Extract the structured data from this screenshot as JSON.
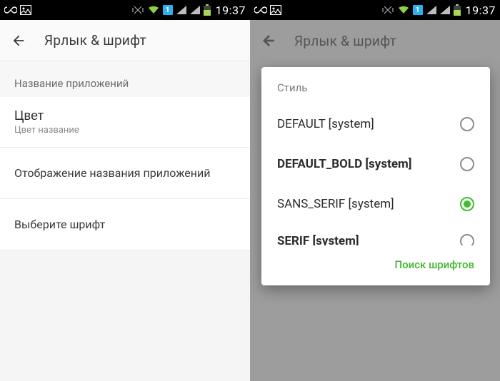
{
  "status": {
    "clock": "19:37"
  },
  "left": {
    "title": "Ярлык & шрифт",
    "section_header": "Название приложений",
    "row_color_title": "Цвет",
    "row_color_sub": "Цвет название",
    "row_display": "Отображение названия приложений",
    "row_pick_font": "Выберите шрифт"
  },
  "right": {
    "title": "Ярлык & шрифт",
    "dialog": {
      "title": "Стиль",
      "options": [
        {
          "label": "DEFAULT [system]",
          "selected": false,
          "bold": false
        },
        {
          "label": "DEFAULT_BOLD [system]",
          "selected": false,
          "bold": true
        },
        {
          "label": "SANS_SERIF [system]",
          "selected": true,
          "bold": false
        },
        {
          "label": "SERIF [system]",
          "selected": false,
          "bold": false
        }
      ],
      "action": "Поиск шрифтов"
    }
  }
}
